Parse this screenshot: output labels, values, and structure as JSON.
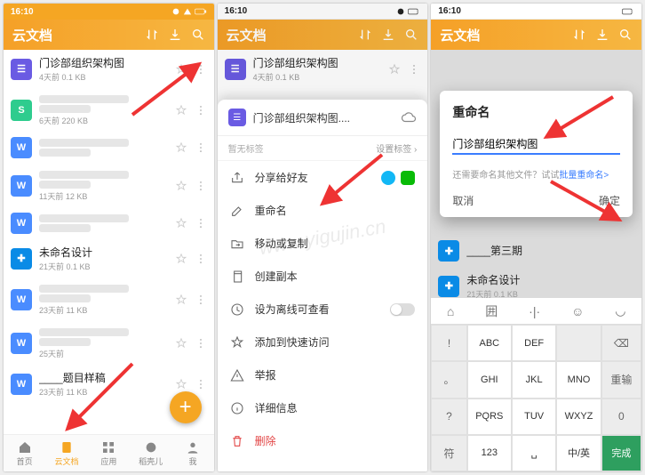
{
  "status": {
    "time": "16:10"
  },
  "app_title": "云文档",
  "watermark": "www.yigujin.cn",
  "phone1": {
    "appbar_icons": [
      "sort",
      "download",
      "search"
    ],
    "topcrumb": "",
    "files": [
      {
        "icon": "pm",
        "glyph": "☰",
        "name": "门诊部组织架构图",
        "info": "4天前 0.1 KB",
        "blur": false
      },
      {
        "icon": "sl",
        "glyph": "S",
        "name": "",
        "info": "6天前 220 KB",
        "blur": true
      },
      {
        "icon": "wd",
        "glyph": "W",
        "name": "",
        "info": "",
        "blur": true
      },
      {
        "icon": "wd",
        "glyph": "W",
        "name": "",
        "info": "11天前 12 KB",
        "blur": true
      },
      {
        "icon": "wd",
        "glyph": "W",
        "name": "",
        "info": "",
        "blur": true
      },
      {
        "icon": "tp",
        "glyph": "✚",
        "name": "未命名设计",
        "info": "21天前 0.1 KB",
        "blur": false
      },
      {
        "icon": "wd",
        "glyph": "W",
        "name": "",
        "info": "23天前 11 KB",
        "blur": true
      },
      {
        "icon": "wd",
        "glyph": "W",
        "name": "",
        "info": "25天前",
        "blur": true
      },
      {
        "icon": "wd",
        "glyph": "W",
        "name": "____题目样稿",
        "info": "23天前 11 KB",
        "blur": false
      }
    ],
    "fab": "+",
    "nav": [
      {
        "label": "首页",
        "icon": "home"
      },
      {
        "label": "云文档",
        "icon": "docs",
        "active": true
      },
      {
        "label": "应用",
        "icon": "apps"
      },
      {
        "label": "稻壳儿",
        "icon": "shell"
      },
      {
        "label": "我",
        "icon": "me"
      }
    ]
  },
  "phone2": {
    "backlist": [
      {
        "name": "门诊部组织架构图",
        "info": "4天前 0.1 KB"
      }
    ],
    "sheet_title": "门诊部组织架构图....",
    "notags": "暂无标签",
    "settag": "设置标签",
    "menu": [
      {
        "id": "share",
        "label": "分享给好友",
        "icon": "share",
        "extras": true
      },
      {
        "id": "rename",
        "label": "重命名",
        "icon": "rename"
      },
      {
        "id": "move",
        "label": "移动或复制",
        "icon": "move"
      },
      {
        "id": "duplicate",
        "label": "创建副本",
        "icon": "duplicate"
      },
      {
        "id": "offline",
        "label": "设为离线可查看",
        "icon": "offline",
        "toggle": true
      },
      {
        "id": "quick",
        "label": "添加到快速访问",
        "icon": "quick"
      },
      {
        "id": "report",
        "label": "举报",
        "icon": "report"
      },
      {
        "id": "details",
        "label": "详细信息",
        "icon": "details"
      },
      {
        "id": "delete",
        "label": "删除",
        "icon": "delete",
        "danger": true
      }
    ]
  },
  "phone3": {
    "dialog": {
      "title": "重命名",
      "input": "门诊部组织架构图",
      "hint_pre": "还需要命名其他文件？试试",
      "hint_link": "批量重命名>",
      "cancel": "取消",
      "ok": "确定"
    },
    "bg_items": [
      {
        "name": "____第三期",
        "info": ""
      },
      {
        "name": "未命名设计",
        "info": "21天前 0.1 KB"
      }
    ],
    "keyboard": {
      "tools": [
        "⌂",
        "囲",
        "·|·",
        "☺",
        "◡"
      ],
      "rows": [
        [
          "!",
          "ABC",
          "DEF",
          "⌫"
        ],
        [
          "。",
          "GHI",
          "JKL",
          "MNO",
          "重输"
        ],
        [
          "?",
          "PQRS",
          "TUV",
          "WXYZ",
          "0"
        ],
        [
          "符",
          "123",
          "␣",
          "中/英",
          "完成"
        ]
      ]
    }
  }
}
